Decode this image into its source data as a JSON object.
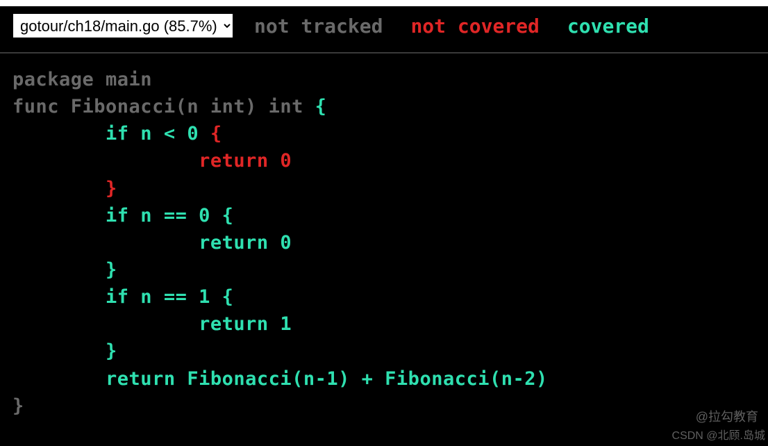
{
  "header": {
    "file_selector": "gotour/ch18/main.go (85.7%)",
    "legend": {
      "not_tracked": "not tracked",
      "not_covered": "not covered",
      "covered": "covered"
    }
  },
  "code": {
    "lines": [
      {
        "class": "not-tracked",
        "text": "package main"
      },
      {
        "class": "not-tracked",
        "text": ""
      },
      {
        "class": "not-tracked",
        "text": "func Fibonacci(n int) int ",
        "brace": "{",
        "brace_class": "covered"
      },
      {
        "class": "covered",
        "text": "        if n < 0 ",
        "brace": "{",
        "brace_class": "not-covered"
      },
      {
        "class": "not-covered",
        "text": "                return 0"
      },
      {
        "class": "not-covered",
        "text": "        }"
      },
      {
        "class": "covered",
        "text": "        if n == 0 {"
      },
      {
        "class": "covered",
        "text": "                return 0"
      },
      {
        "class": "covered",
        "text": "        }"
      },
      {
        "class": "covered",
        "text": "        if n == 1 {"
      },
      {
        "class": "covered",
        "text": "                return 1"
      },
      {
        "class": "covered",
        "text": "        }"
      },
      {
        "class": "covered",
        "text": "        return Fibonacci(n-1) + Fibonacci(n-2)"
      },
      {
        "class": "not-tracked",
        "text": "}"
      }
    ]
  },
  "watermarks": {
    "w1": "@拉勾教育",
    "w2": "CSDN @北顾.岛城"
  }
}
